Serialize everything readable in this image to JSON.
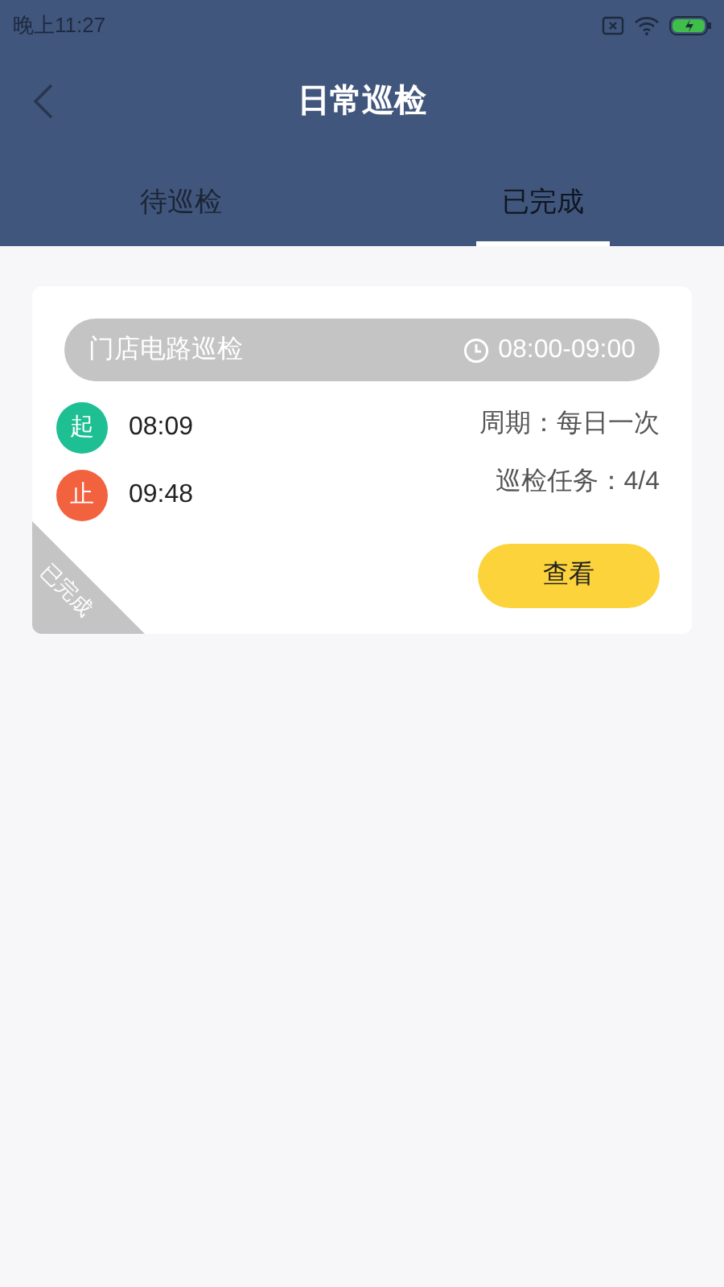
{
  "status_bar": {
    "time": "晚上11:27"
  },
  "header": {
    "title": "日常巡检"
  },
  "tabs": [
    {
      "label": "待巡检",
      "selected": false
    },
    {
      "label": "已完成",
      "selected": true
    }
  ],
  "tasks": [
    {
      "name": "门店电路巡检",
      "time_window": "08:00-09:00",
      "ribbon": "已完成",
      "cycle": "周期：每日一次",
      "progress": "巡检任务：4/4",
      "button": "查看",
      "events": [
        {
          "mark": "起",
          "color": "#1fbf94",
          "time": "08:09"
        },
        {
          "mark": "止",
          "color": "#f2623f",
          "time": "09:48"
        }
      ]
    }
  ]
}
